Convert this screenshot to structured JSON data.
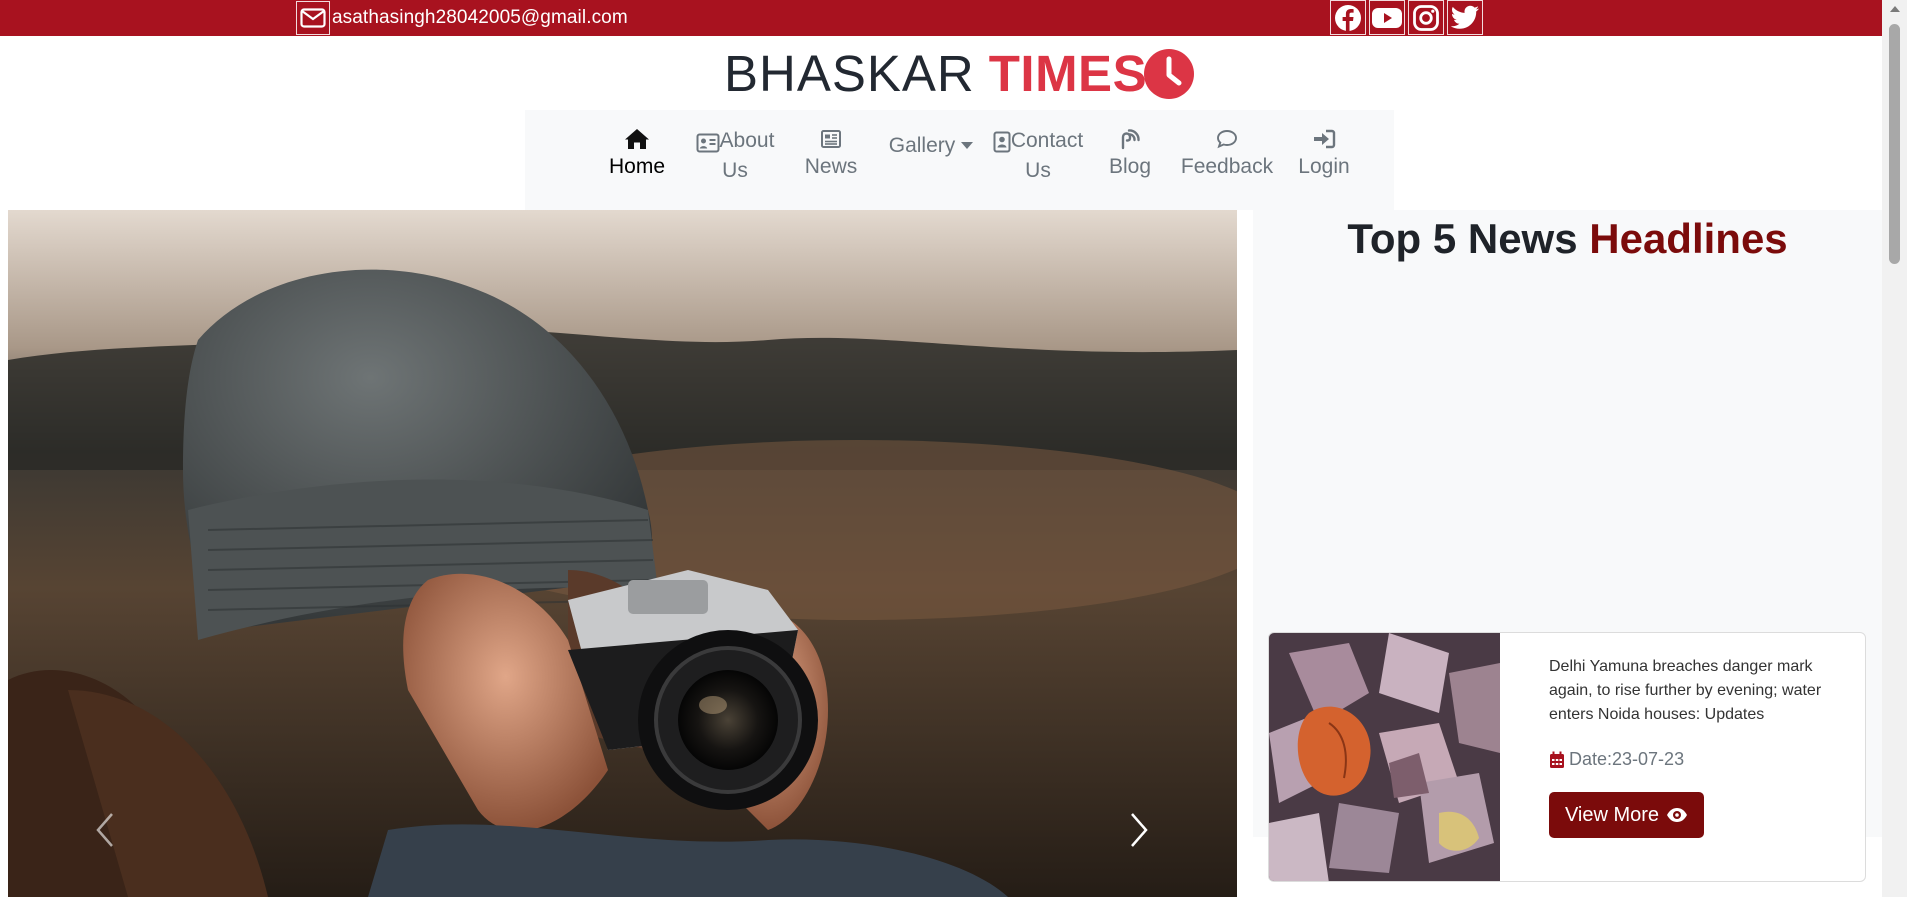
{
  "topbar": {
    "email": "asathasingh28042005@gmail.com",
    "background": "#a8121f",
    "social_icons": [
      "facebook-icon",
      "youtube-icon",
      "instagram-icon",
      "twitter-icon"
    ]
  },
  "logo": {
    "part1": "BHASKAR",
    "part2": "TIMES",
    "accent_color": "#dc3545"
  },
  "nav": {
    "items": [
      {
        "label_line1": "Home",
        "label_line2": "",
        "icon": "home-icon",
        "active": true
      },
      {
        "label_line1": "About",
        "label_line2": "Us",
        "icon": "id-card-icon",
        "active": false
      },
      {
        "label_line1": "News",
        "label_line2": "",
        "icon": "newspaper-icon",
        "active": false
      },
      {
        "label_line1": "Gallery",
        "label_line2": "",
        "icon": "caret-down-icon",
        "active": false
      },
      {
        "label_line1": "Contact",
        "label_line2": "Us",
        "icon": "contact-card-icon",
        "active": false
      },
      {
        "label_line1": "Blog",
        "label_line2": "",
        "icon": "blog-icon",
        "active": false
      },
      {
        "label_line1": "Feedback",
        "label_line2": "",
        "icon": "chat-bubble-icon",
        "active": false
      },
      {
        "label_line1": "Login",
        "label_line2": "",
        "icon": "login-icon",
        "active": false
      }
    ]
  },
  "carousel": {
    "prev_icon": "chevron-left-icon",
    "next_icon": "chevron-right-icon"
  },
  "sidebar": {
    "title_part1": "Top 5 News",
    "title_part2": "Headlines",
    "highlight_color": "#7b0b0b"
  },
  "news_card": {
    "headline": "Delhi Yamuna breaches danger mark again, to rise further by evening; water enters Noida houses: Updates",
    "date": "Date:23-07-23",
    "button_label": "View More",
    "button_color": "#7b0b0b"
  }
}
